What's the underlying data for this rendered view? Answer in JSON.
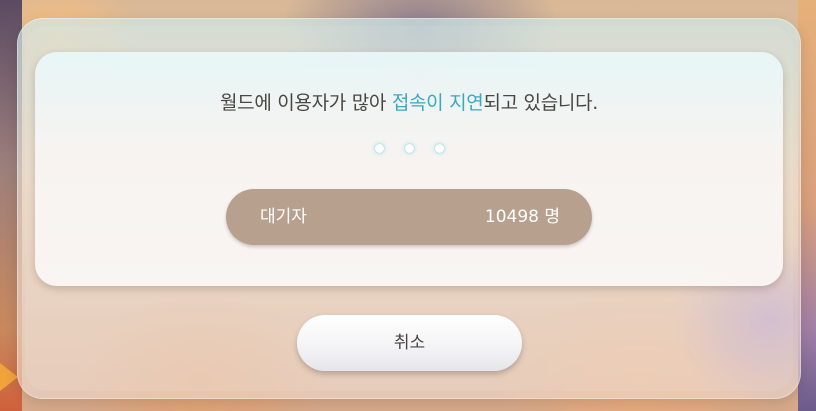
{
  "dialog": {
    "message_prefix": "월드에 이용자가 많아 ",
    "message_highlight": "접속이 지연",
    "message_suffix": "되고 있습니다.",
    "highlight_color": "#3aa8c0"
  },
  "queue": {
    "label": "대기자",
    "count": "10498 명"
  },
  "actions": {
    "cancel_label": "취소"
  }
}
